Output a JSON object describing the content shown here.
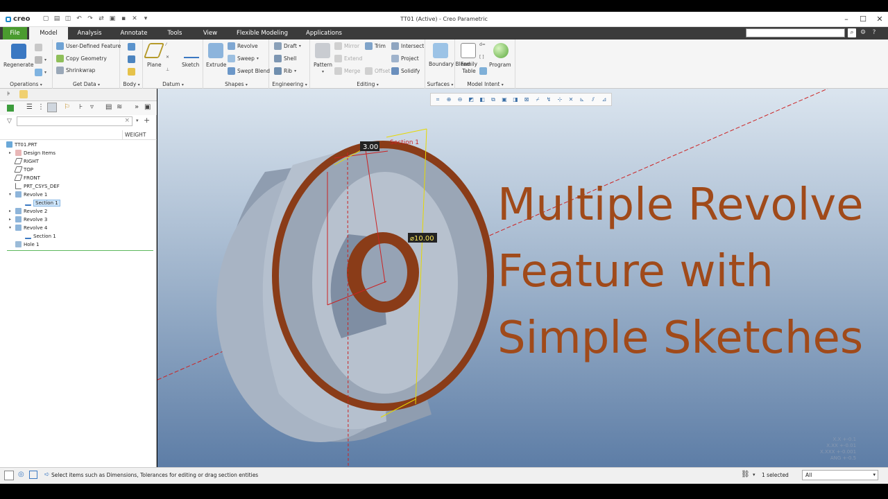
{
  "app": {
    "name": "creo",
    "window_title": "TT01 (Active) - Creo Parametric"
  },
  "tabs": [
    "File",
    "Model",
    "Analysis",
    "Annotate",
    "Tools",
    "View",
    "Flexible Modeling",
    "Applications"
  ],
  "active_tab": "Model",
  "ribbon": {
    "operations": {
      "regenerate": "Regenerate",
      "label": "Operations"
    },
    "get_data": {
      "user_defined": "User-Defined Feature",
      "copy_geometry": "Copy Geometry",
      "shrinkwrap": "Shrinkwrap",
      "label": "Get Data"
    },
    "body": {
      "label": "Body"
    },
    "datum": {
      "plane": "Plane",
      "sketch": "Sketch",
      "label": "Datum"
    },
    "shapes": {
      "extrude": "Extrude",
      "revolve": "Revolve",
      "sweep": "Sweep",
      "swept_blend": "Swept Blend",
      "label": "Shapes"
    },
    "engineering": {
      "draft": "Draft",
      "shell": "Shell",
      "rib": "Rib",
      "label": "Engineering"
    },
    "editing": {
      "pattern": "Pattern",
      "mirror": "Mirror",
      "extend": "Extend",
      "merge": "Merge",
      "trim": "Trim",
      "offset": "Offset",
      "intersect": "Intersect",
      "project": "Project",
      "solidify": "Solidify",
      "label": "Editing"
    },
    "surfaces": {
      "boundary_blend": "Boundary Blend",
      "label": "Surfaces"
    },
    "model_intent": {
      "family_table": "Family Table",
      "program": "Program",
      "label": "Model Intent"
    }
  },
  "model_tree": {
    "column_header": "WEIGHT",
    "items": [
      {
        "label": "TT01.PRT"
      },
      {
        "label": "Design Items"
      },
      {
        "label": "RIGHT"
      },
      {
        "label": "TOP"
      },
      {
        "label": "FRONT"
      },
      {
        "label": "PRT_CSYS_DEF"
      },
      {
        "label": "Revolve 1"
      },
      {
        "label": "Section 1"
      },
      {
        "label": "Revolve 2"
      },
      {
        "label": "Revolve 3"
      },
      {
        "label": "Revolve 4"
      },
      {
        "label": "Section 1"
      },
      {
        "label": "Hole 1"
      }
    ]
  },
  "viewport": {
    "dim_thickness": "3.00",
    "dim_diameter": "⌀10.00",
    "section_label": "Section 1",
    "overlay_lines": [
      "Multiple Revolve",
      "Feature with",
      "Simple Sketches"
    ],
    "tolerances": [
      "X.X +-0.1",
      "X.XX +-0.01",
      "X.XXX +-0.001",
      "ANG +-0.5"
    ]
  },
  "status": {
    "message": "Select items such as Dimensions, Tolerances for editing or drag section entities",
    "selected": "1 selected",
    "filter": "All"
  },
  "colors": {
    "accent_green": "#4a9b2f",
    "title_text": "#a04a1a",
    "section_fill": "#8b3d1c"
  }
}
